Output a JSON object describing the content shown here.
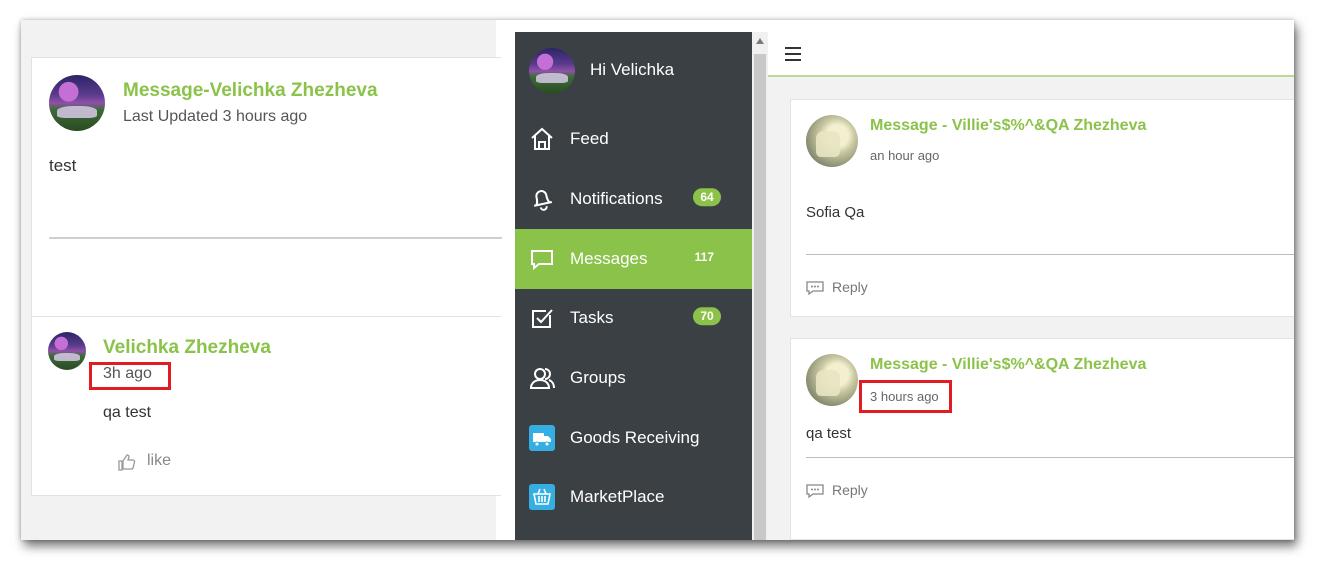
{
  "left": {
    "post": {
      "title": "Message-Velichka Zhezheva",
      "updated": "Last Updated 3 hours ago",
      "body": "test"
    },
    "comment": {
      "author": "Velichka Zhezheva",
      "time": "3h ago",
      "text": "qa test",
      "like_label": "like"
    }
  },
  "sidebar": {
    "greeting": "Hi Velichka",
    "items": [
      {
        "label": "Feed",
        "icon": "home-icon",
        "badge": ""
      },
      {
        "label": "Notifications",
        "icon": "bell-icon",
        "badge": "64"
      },
      {
        "label": "Messages",
        "icon": "chat-icon",
        "badge": "117",
        "active": true
      },
      {
        "label": "Tasks",
        "icon": "tasks-check-icon",
        "badge": "70"
      },
      {
        "label": "Groups",
        "icon": "groups-icon",
        "badge": ""
      },
      {
        "label": "Goods Receiving",
        "icon": "truck-icon",
        "badge": ""
      },
      {
        "label": "MarketPlace",
        "icon": "basket-icon",
        "badge": ""
      }
    ]
  },
  "right": {
    "menu_icon": "hamburger-icon",
    "messages": [
      {
        "title": "Message - Villie's$%^&QA Zhezheva",
        "time": "an hour ago",
        "body": "Sofia Qa",
        "reply_label": "Reply"
      },
      {
        "title": "Message - Villie's$%^&QA Zhezheva",
        "time": "3 hours ago",
        "body": "qa test",
        "reply_label": "Reply"
      }
    ]
  },
  "colors": {
    "accent": "#8bc34a",
    "sidebar_bg": "#3b4044",
    "highlight": "#e11d24",
    "badge_icon_blue": "#35aee3"
  }
}
